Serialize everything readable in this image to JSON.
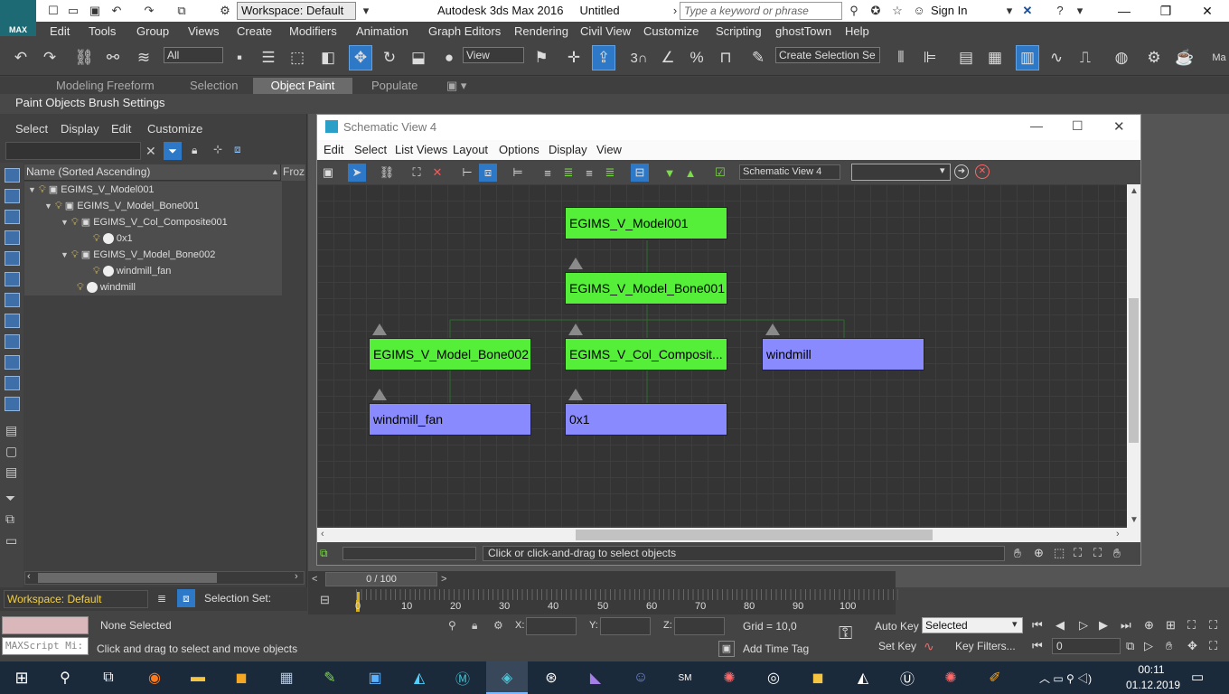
{
  "titlebar": {
    "logo": "MAX",
    "workspace": "Workspace: Default",
    "title": "Autodesk 3ds Max 2016",
    "doc": "Untitled",
    "search_placeholder": "Type a keyword or phrase",
    "signin": "Sign In"
  },
  "menus": [
    "Edit",
    "Tools",
    "Group",
    "Views",
    "Create",
    "Modifiers",
    "Animation",
    "Graph Editors",
    "Rendering",
    "Civil View",
    "Customize",
    "Scripting",
    "ghostTown",
    "Help"
  ],
  "toolbar": {
    "filter": "All",
    "refcoord": "View",
    "selection_set": "Create Selection Se",
    "snap3": "3"
  },
  "ribbon": {
    "tabs": [
      "Modeling",
      "Freeform",
      "Selection",
      "Object Paint",
      "Populate"
    ],
    "active": "Object Paint",
    "subtabs": [
      "Paint Objects",
      "Brush Settings"
    ]
  },
  "scene_explorer": {
    "menus": [
      "Select",
      "Display",
      "Edit",
      "Customize"
    ],
    "header": "Name (Sorted Ascending)",
    "header2": "Froz",
    "rows": [
      {
        "label": "EGIMS_V_Model001"
      },
      {
        "label": "EGIMS_V_Model_Bone001"
      },
      {
        "label": "EGIMS_V_Col_Composite001"
      },
      {
        "label": "0x1"
      },
      {
        "label": "EGIMS_V_Model_Bone002"
      },
      {
        "label": "windmill_fan"
      },
      {
        "label": "windmill"
      }
    ],
    "workspace": "Workspace: Default",
    "selection_set_label": "Selection Set:"
  },
  "schematic": {
    "title": "Schematic View 4",
    "menus": [
      "Edit",
      "Select",
      "List Views",
      "Layout",
      "Options",
      "Display",
      "View"
    ],
    "view_name": "Schematic View 4",
    "status": "Click or click-and-drag to select objects",
    "nodes": [
      {
        "label": "EGIMS_V_Model001",
        "color": "#55ef3a"
      },
      {
        "label": "EGIMS_V_Model_Bone001",
        "color": "#55ef3a"
      },
      {
        "label": "EGIMS_V_Model_Bone002",
        "color": "#55ef3a"
      },
      {
        "label": "EGIMS_V_Col_Composit...",
        "color": "#55ef3a"
      },
      {
        "label": "windmill",
        "color": "#8a8aff"
      },
      {
        "label": "windmill_fan",
        "color": "#8a8aff"
      },
      {
        "label": "0x1",
        "color": "#8a8aff"
      }
    ]
  },
  "timeline": {
    "frame": "0 / 100",
    "ticks": [
      "0",
      "10",
      "20",
      "30",
      "40",
      "50",
      "60",
      "70",
      "80",
      "90",
      "100"
    ]
  },
  "status": {
    "maxscript": "MAXScript Mi:",
    "selection": "None Selected",
    "prompt": "Click and drag to select and move objects",
    "x_label": "X:",
    "y_label": "Y:",
    "z_label": "Z:",
    "grid": "Grid = 10,0",
    "add_time_tag": "Add Time Tag",
    "auto_key": "Auto Key",
    "set_key": "Set Key",
    "key_mode": "Selected",
    "key_filters": "Key Filters...",
    "frame_field": "0"
  },
  "taskbar": {
    "time": "00:11",
    "date": "01.12.2019"
  }
}
